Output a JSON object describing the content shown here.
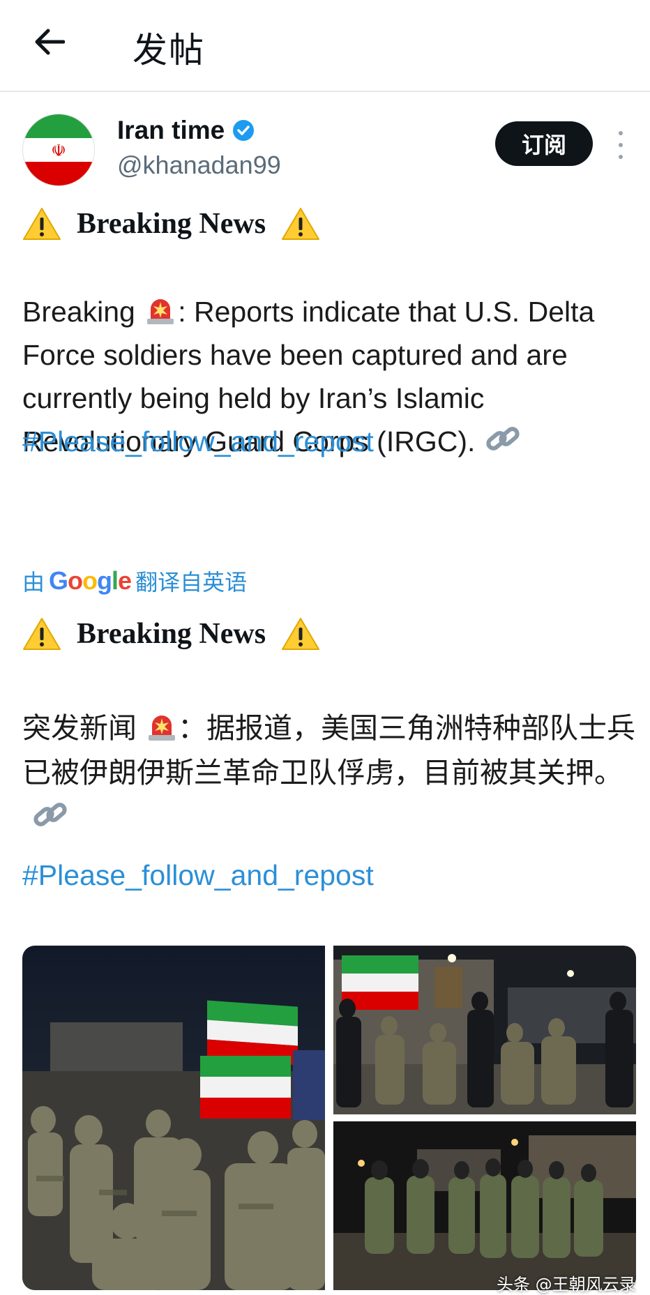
{
  "header": {
    "title": "发帖"
  },
  "author": {
    "display_name": "Iran time",
    "handle": "@khanadan99",
    "subscribe_label": "订阅"
  },
  "post": {
    "headline_1": "Breaking News",
    "en_text_1": "Breaking",
    "en_text_2": ": Reports indicate that U.S. Delta Force soldiers have been captured and are currently being held by Iran’s Islamic Revolutionary Guard Corps (IRGC).",
    "hashtag": "#Please_follow_and_repost",
    "translate_prefix": "由",
    "translate_brand": "Google",
    "translate_suffix": "翻译自英语",
    "headline_2": "Breaking News",
    "zh_text_1": "突发新闻",
    "zh_text_2": "：据报道，美国三角洲特种部队士兵已被伊朗伊斯兰革命卫队俘虏，目前被其关押。",
    "hashtag_2": "#Please_follow_and_repost"
  },
  "watermark": "头条 @王朝风云录",
  "colors": {
    "link": "#2b8fd6",
    "verified": "#1d9bf0",
    "button_bg": "#0f1419"
  },
  "icons": [
    "back-arrow-icon",
    "verified-badge-icon",
    "more-icon",
    "warning-icon",
    "siren-icon",
    "link-icon"
  ]
}
